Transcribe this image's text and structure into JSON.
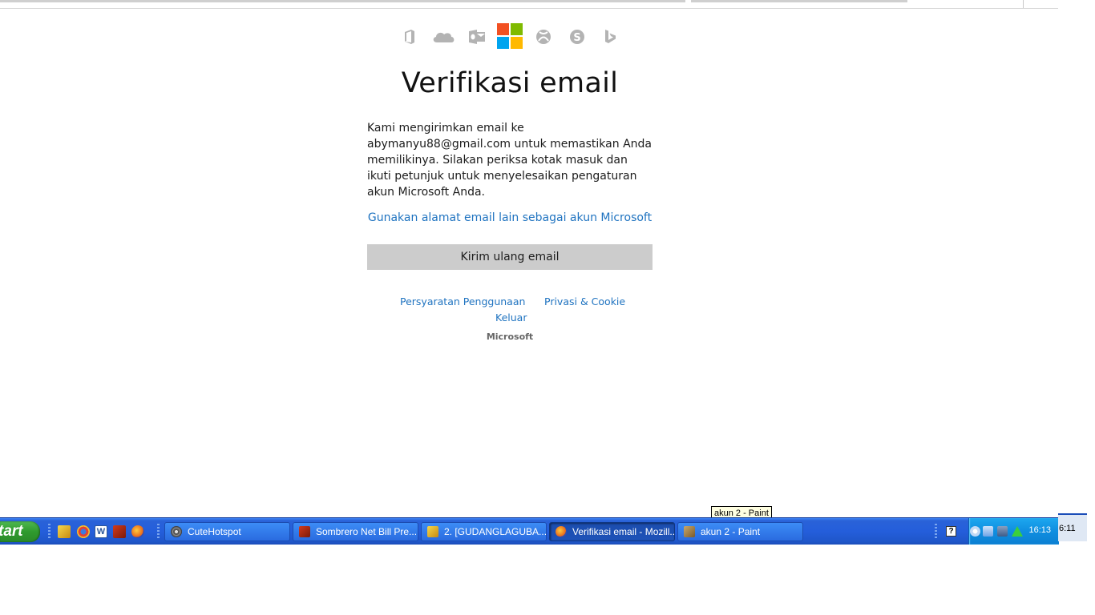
{
  "page": {
    "title": "Verifikasi email",
    "description": "Kami mengirimkan email ke abymanyu88@gmail.com untuk memastikan Anda memilikinya. Silakan periksa kotak masuk dan ikuti petunjuk untuk menyelesaikan pengaturan akun Microsoft Anda.",
    "alt_email_link": "Gunakan alamat email lain sebagai akun Microsoft",
    "resend_button": "Kirim ulang email",
    "footer_links": {
      "terms": "Persyaratan Penggunaan",
      "privacy": "Privasi & Cookie",
      "signout": "Keluar"
    },
    "footer_brand": "Microsoft"
  },
  "product_icons": [
    "office-icon",
    "onedrive-icon",
    "outlook-icon",
    "microsoft-logo",
    "xbox-icon",
    "skype-icon",
    "bing-icon"
  ],
  "colors": {
    "link": "#1f73c0",
    "button_bg": "#cccccc",
    "icon_gray": "#b3b3b3",
    "ms_red": "#f25022",
    "ms_green": "#7fba00",
    "ms_blue": "#00a4ef",
    "ms_yellow": "#ffb900",
    "taskbar_blue": "#245edb",
    "start_green": "#3aa53a"
  },
  "tooltip": "akun 2 - Paint",
  "taskbar": {
    "start_label": "tart",
    "quick_launch": [
      "flashget-icon",
      "chrome-icon",
      "word-icon",
      "sombrero-icon",
      "firefox-icon"
    ],
    "buttons": [
      {
        "label": "CuteHotspot",
        "icon": "wifi-icon",
        "active": false
      },
      {
        "label": "Sombrero Net Bill Pre...",
        "icon": "sombrero-icon",
        "active": false
      },
      {
        "label": "2. [GUDANGLAGUBA...",
        "icon": "flashget-icon",
        "active": false
      },
      {
        "label": "Verifikasi email - Mozill...",
        "icon": "firefox-icon",
        "active": true
      },
      {
        "label": "akun 2 - Paint",
        "icon": "paint-icon",
        "active": false
      }
    ],
    "clock": "16:13",
    "side_clock": "6:11"
  }
}
